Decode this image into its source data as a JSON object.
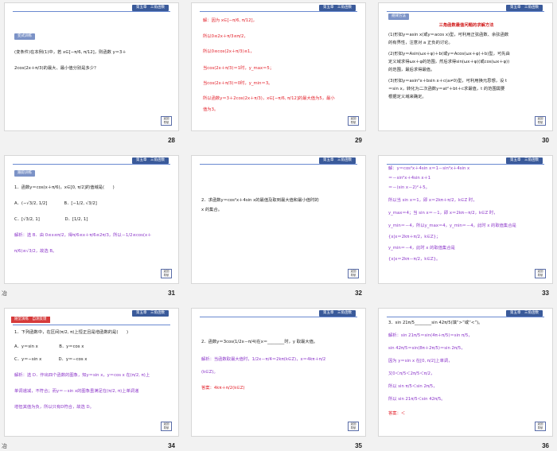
{
  "header_label": "第五章　三角函数",
  "nav_label": [
    "返回",
    "导航"
  ],
  "bottom_glyph": "冶",
  "slides": [
    {
      "num": "28",
      "tag": "变式训练",
      "lines": [
        "(变条件)在本例(1)中，若 x∈[−π/6, π/12]，则函数 y＝3＋",
        "2cos(2x＋π/3)的最大、最小值分别是多少？"
      ]
    },
    {
      "num": "29",
      "lines": [
        "解：因为 x∈[−π/6, π/12]，",
        "所以0≤2x＋π/3≤π/2，",
        "所以0≤cos(2x＋π/3)≤1，",
        "当cos(2x＋π/3)＝1时，y_max＝5；",
        "当cos(2x＋π/3)＝0时，y_min＝3。",
        "所以函数y＝3＋2cos(2x＋π/3)，x∈[−π/6, π/12]的最大值为5，最小",
        "值为3。"
      ]
    },
    {
      "num": "30",
      "tag": "规律方法",
      "title": "三角函数最值问题的求解方法",
      "lines": [
        "(1)形如y＝asin x(或y＝acos x)型，可利用正弦函数、余弦函数",
        "的有界性，注意对 a 正负的讨论。",
        "(2)形如y＝Asin(ωx＋φ)＋b(或y＝Acos(ωx＋φ)＋b)型，可先由",
        "定义域求得ωx＋φ的范围，然后求得sin(ωx＋φ)(或cos(ωx＋φ))",
        "的范围，最后求得最值。",
        "(3)形如y＝asin²x＋bsin x＋c(a≠0)型，可利用换元思想，设 t",
        "＝sin x，转化为二次函数y＝at²＋bt＋c求最值，t 的范围需要",
        "根据定义域来确定。"
      ]
    },
    {
      "num": "31",
      "tag": "跟踪训练",
      "lines": [
        "1．函数y＝cos(x＋π/6)，x∈[0, π/2]的值域是(　　)",
        "A．(−√3/2, 1/2]　　　　B．[−1/2, √3/2]",
        "C．[√3/2, 1]　　　　　　D．[1/2, 1]",
        "解析：选 B．由 0≤x≤π/2，得π/6≤x＋π/6≤2π/3，所以－1/2≤cos(x＋",
        "π/6)≤√3/2，故选 B。"
      ]
    },
    {
      "num": "32",
      "lines": [
        "2．求函数y＝cos²x＋4sin x的最值及取到最大值和最小值时的",
        "x 的集合。"
      ]
    },
    {
      "num": "33",
      "lines": [
        "解：y＝cos²x＋4sin x＝1－sin²x＋4sin x",
        "＝－sin²x＋4sin x＋1",
        "＝－(sin x－2)²＋5。",
        "所以当 sin x＝1，即 x＝2kπ＋π/2，k∈Z 时，",
        "y_max＝4；当 sin x＝－1，即 x＝2kπ－π/2，k∈Z 时，",
        "y_min＝－4，所以y_max＝4，y_min＝－4。此时 x 的取值集合是",
        "{x|x＝2kπ＋π/2，k∈Z}；",
        "y_min＝－4，此时 x 的取值集合是",
        "{x|x＝2kπ－π/2，k∈Z}。"
      ]
    },
    {
      "num": "34",
      "tag": "随堂演练　自测反馈",
      "lines": [
        "1．下列函数中，在区间(π/2, π)上恒正且是增函数的是(　　)",
        "A．y＝sin x　　　　　B．y＝cos x",
        "C．y＝−sin x　　　　D．y＝−cos x",
        "解析：选 D．作出四个函数的图象，知y＝sin x，y＝cos x 在(π/2, π)上",
        "单调递减，不符合；而y＝－sin x的图象虽满足在(π/2, π)上单调递",
        "增但其值为负，所以只有D符合，故选 D。"
      ]
    },
    {
      "num": "35",
      "lines": [
        "2．函数y＝3cos(1/2x－π/4)在x＝________时，y 取最大值。",
        "解析：当函数取最大值时，1/2x－π/4＝2kπ(k∈Z)，x＝4kπ＋π/2",
        "(k∈Z)。",
        "答案：4kπ＋π/2(k∈Z)"
      ]
    },
    {
      "num": "36",
      "lines": [
        "3．sin 21π/5________sin 42π/5(填“>”或“<”)。",
        "解析：sin 21π/5＝sin(4π＋π/5)＝sin π/5，",
        "sin 42π/5＝sin(8π＋2π/5)＝sin 2π/5，",
        "因为 y＝sin x 在[0, π/2]上单调，",
        "又0＜π/5＜2π/5＜π/2，",
        "所以 sin π/5＜sin 2π/5，",
        "所以 sin 21π/5＜sin 42π/5。",
        "答案：＜"
      ]
    }
  ]
}
